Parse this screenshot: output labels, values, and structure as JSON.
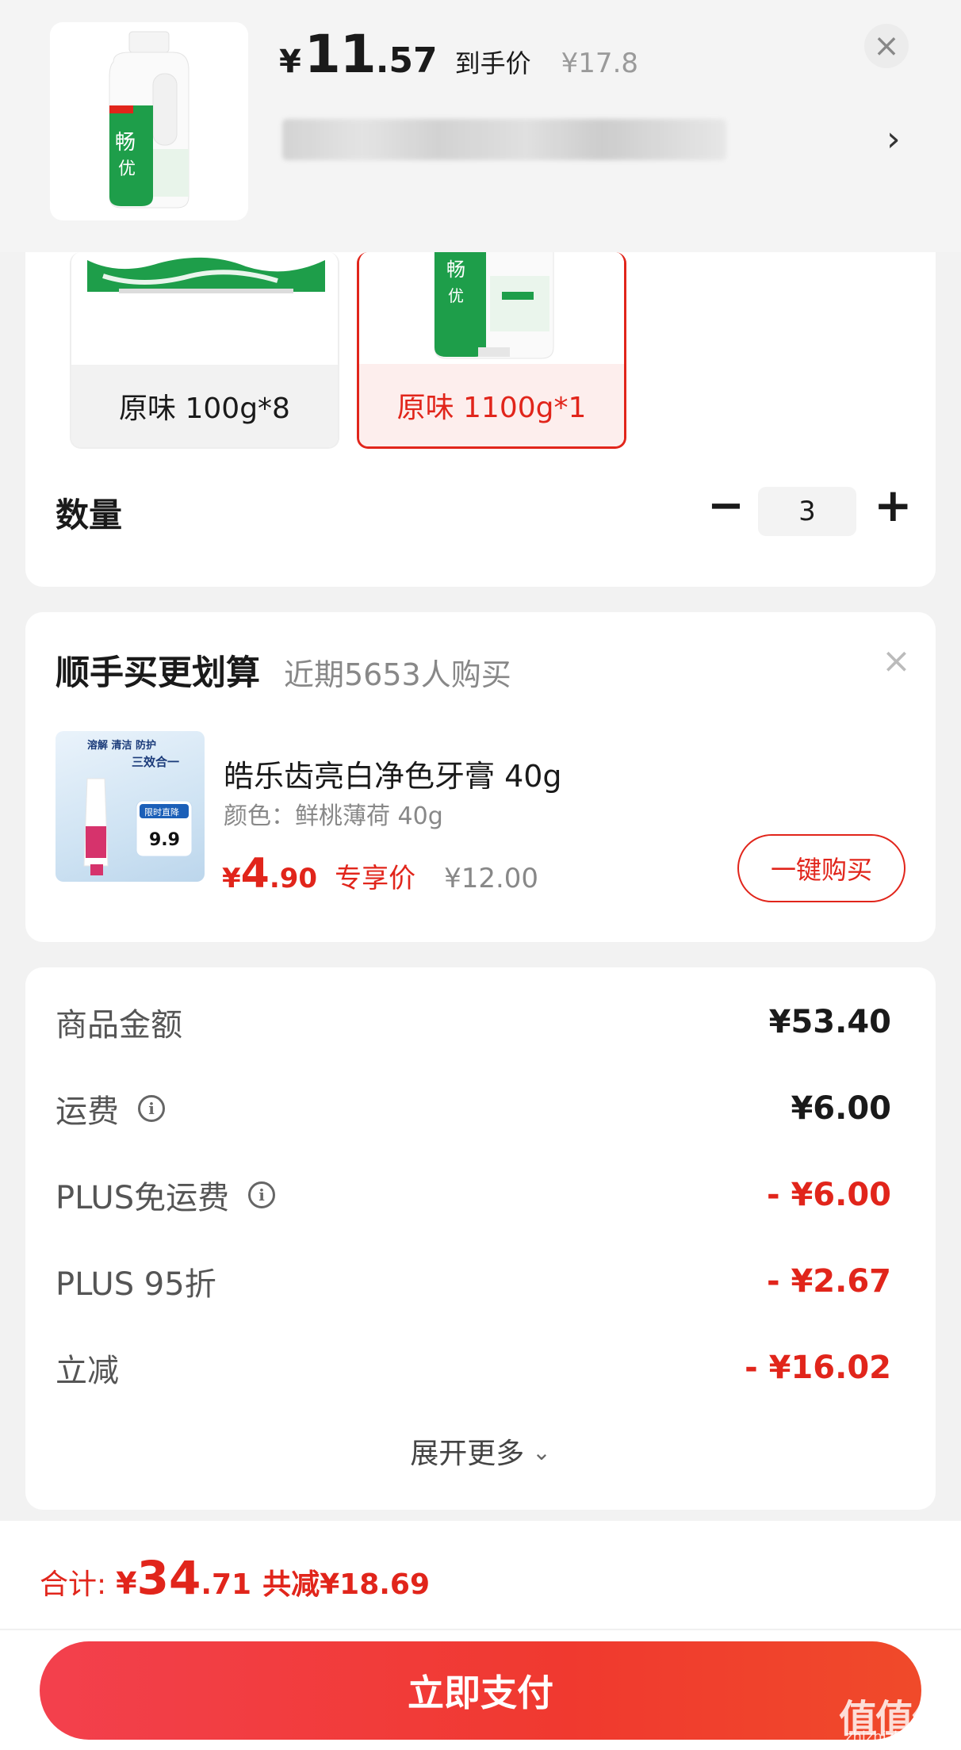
{
  "header": {
    "price_symbol": "¥",
    "price_int": "11",
    "price_dec": ".57",
    "price_label": "到手价",
    "original_price": "¥17.8",
    "close": "×",
    "chevron": "›"
  },
  "specs": {
    "options": [
      {
        "label": "原味 100g*8",
        "selected": false
      },
      {
        "label": "原味 1100g*1",
        "selected": true
      }
    ],
    "quantity_label": "数量",
    "minus": "−",
    "quantity": "3",
    "plus": "+"
  },
  "addon": {
    "title": "顺手买更划算",
    "subtitle": "近期5653人购买",
    "close": "×",
    "name": "皓乐齿亮白净色牙膏 40g",
    "spec": "颜色：鲜桃薄荷 40g",
    "price_symbol": "¥",
    "price_int": "4",
    "price_dec": ".90",
    "price_tag": "专享价",
    "original_price": "¥12.00",
    "buy_label": "一键购买",
    "thumb_text": {
      "line1": "溶解 清洁 防护",
      "line2": "三效合一",
      "badge": "限时直降",
      "badge_price": "9.9"
    }
  },
  "details": {
    "rows": [
      {
        "label": "商品金额",
        "value": "¥53.40",
        "info": false,
        "red": false
      },
      {
        "label": "运费",
        "value": "¥6.00",
        "info": true,
        "red": false
      },
      {
        "label": "PLUS免运费",
        "value": "- ¥6.00",
        "info": true,
        "red": true
      },
      {
        "label": "PLUS 95折",
        "value": "- ¥2.67",
        "info": false,
        "red": true
      },
      {
        "label": "立减",
        "value": "- ¥16.02",
        "info": false,
        "red": true
      }
    ],
    "expand_label": "展开更多",
    "expand_chevron": "⌄"
  },
  "footer": {
    "total_label": "合计:",
    "total_symbol": "¥",
    "total_int": "34",
    "total_dec": ".71",
    "saved": "共减¥18.69",
    "pay_label": "立即支付",
    "watermark": "值值值",
    "watermark_sub": "zhizhizhi.com"
  },
  "colors": {
    "accent": "#e1251b",
    "pay_button": "#f0392f",
    "product_green": "#1e9e4a"
  }
}
